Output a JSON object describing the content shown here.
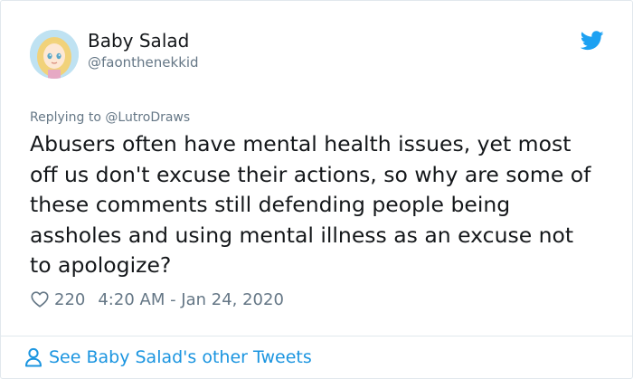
{
  "tweet": {
    "author": {
      "display_name": "Baby Salad",
      "handle": "@faonthenekkid",
      "avatar_icon": "avatar-cartoon-girl"
    },
    "platform_icon": "twitter-bird-icon",
    "reply": {
      "prefix": "Replying to",
      "mention": "@LutroDraws"
    },
    "text": "Abusers often have mental health issues, yet most\noff us don't excuse their actions, so why are some of\nthese comments still defending people being\nassholes and using mental illness as an excuse not\nto apologize?",
    "likes": "220",
    "timestamp": "4:20 AM - Jan 24, 2020",
    "footer_link": "See Baby Salad's other Tweets"
  },
  "colors": {
    "text_primary": "#14171a",
    "text_secondary": "#657786",
    "accent": "#1b95e0",
    "border": "#e1e8ed"
  }
}
